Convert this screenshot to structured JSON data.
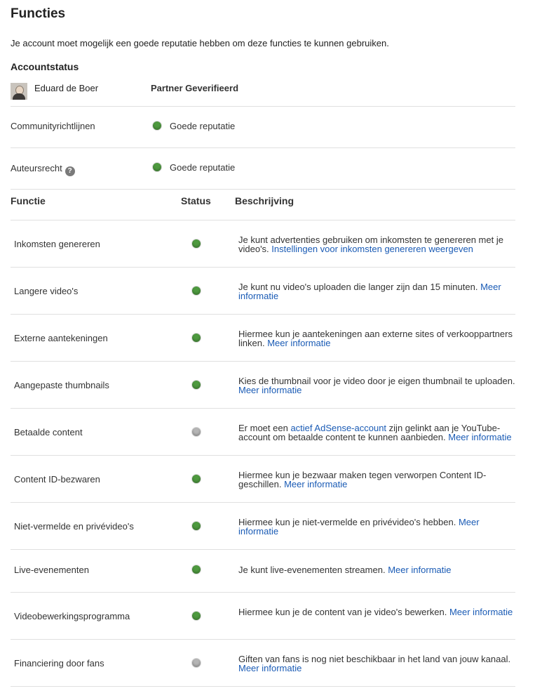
{
  "title": "Functies",
  "intro": "Je account moet mogelijk een goede reputatie hebben om deze functies te kunnen gebruiken.",
  "account": {
    "heading": "Accountstatus",
    "user_name": "Eduard de Boer",
    "partner_status": "Partner Geverifieerd",
    "community_label": "Communityrichtlijnen",
    "community_status": "Goede reputatie",
    "copyright_label": "Auteursrecht",
    "copyright_help": "?",
    "copyright_status": "Goede reputatie"
  },
  "table": {
    "col_feature": "Functie",
    "col_status": "Status",
    "col_desc": "Beschrijving"
  },
  "features": [
    {
      "name": "Inkomsten genereren",
      "status": "green",
      "desc_text": "Je kunt advertenties gebruiken om inkomsten te genereren met je video's.",
      "link": "Instellingen voor inkomsten genereren weergeven"
    },
    {
      "name": "Langere video's",
      "status": "green",
      "desc_text": "Je kunt nu video's uploaden die langer zijn dan 15 minuten.",
      "link": "Meer informatie"
    },
    {
      "name": "Externe aantekeningen",
      "status": "green",
      "desc_text": "Hiermee kun je aantekeningen aan externe sites of verkooppartners linken.",
      "link": "Meer informatie"
    },
    {
      "name": "Aangepaste thumbnails",
      "status": "green",
      "desc_text": "Kies de thumbnail voor je video door je eigen thumbnail te uploaden.",
      "link": "Meer informatie"
    },
    {
      "name": "Betaalde content",
      "status": "gray",
      "desc_pre": "Er moet een",
      "desc_link_inline": "actief AdSense-account",
      "desc_text": "zijn gelinkt aan je YouTube-account om betaalde content te kunnen aanbieden.",
      "link": "Meer informatie"
    },
    {
      "name": "Content ID-bezwaren",
      "status": "green",
      "desc_text": "Hiermee kun je bezwaar maken tegen verworpen Content ID-geschillen.",
      "link": "Meer informatie"
    },
    {
      "name": "Niet-vermelde en privévideo's",
      "status": "green",
      "desc_text": "Hiermee kun je niet-vermelde en privévideo's hebben.",
      "link": "Meer informatie"
    },
    {
      "name": "Live-evenementen",
      "status": "green",
      "desc_text": "Je kunt live-evenementen streamen.",
      "link": "Meer informatie"
    },
    {
      "name": "Videobewerkingsprogramma",
      "status": "green",
      "desc_text": "Hiermee kun je de content van je video's bewerken.",
      "link": "Meer informatie"
    },
    {
      "name": "Financiering door fans",
      "status": "gray",
      "desc_text": "Giften van fans is nog niet beschikbaar in het land van jouw kanaal.",
      "link": "Meer informatie"
    }
  ],
  "colors": {
    "green": "#4e9a3f",
    "gray": "#b5b5b5",
    "link": "#1a5bb5"
  }
}
